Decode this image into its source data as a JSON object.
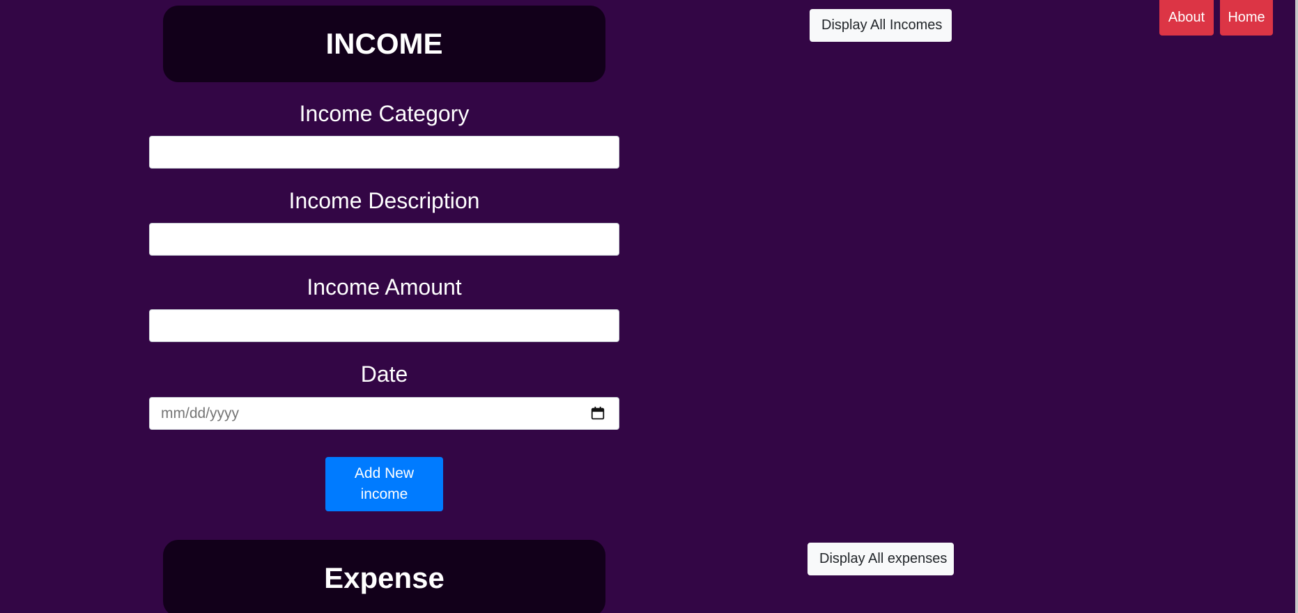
{
  "nav": {
    "about_label": "About",
    "home_label": "Home"
  },
  "income": {
    "title": "INCOME",
    "display_all_label": "Display All Incomes",
    "category_label": "Income Category",
    "category_value": "",
    "description_label": "Income Description",
    "description_value": "",
    "amount_label": "Income Amount",
    "amount_value": "",
    "date_label": "Date",
    "date_placeholder": "mm/dd/yyyy",
    "add_button_label": "Add New income"
  },
  "expense": {
    "title": "Expense",
    "display_all_label": "Display All expenses"
  },
  "icons": {
    "calendar": "calendar-icon"
  },
  "colors": {
    "background": "#330645",
    "header_bg": "#12001a",
    "primary": "#007bff",
    "danger": "#dc3545",
    "light": "#f8f9fa"
  }
}
